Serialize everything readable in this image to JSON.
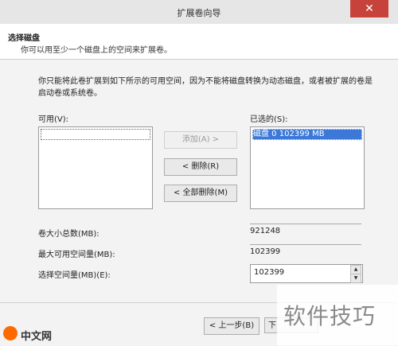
{
  "window": {
    "title": "扩展卷向导",
    "close_symbol": "✕"
  },
  "header": {
    "title": "选择磁盘",
    "subtitle": "你可以用至少一个磁盘上的空间来扩展卷。"
  },
  "description": "你只能将此卷扩展到如下所示的可用空间，因为不能将磁盘转换为动态磁盘，或者被扩展的卷是启动卷或系统卷。",
  "available": {
    "label": "可用(V):",
    "items": [
      ""
    ]
  },
  "selected": {
    "label": "已选的(S):",
    "items": [
      "磁盘 0    102399 MB"
    ]
  },
  "buttons": {
    "add": "添加(A) >",
    "remove": "< 删除(R)",
    "remove_all": "< 全部删除(M)",
    "back": "< 上一步(B)",
    "next": "下"
  },
  "fields": {
    "total_label": "卷大小总数(MB):",
    "total_value": "921248",
    "max_label": "最大可用空间量(MB):",
    "max_value": "102399",
    "select_label": "选择空间量(MB)(E):",
    "select_value": "102399"
  },
  "watermark": {
    "text": "软件技巧"
  },
  "logo": {
    "text": "中文网"
  }
}
